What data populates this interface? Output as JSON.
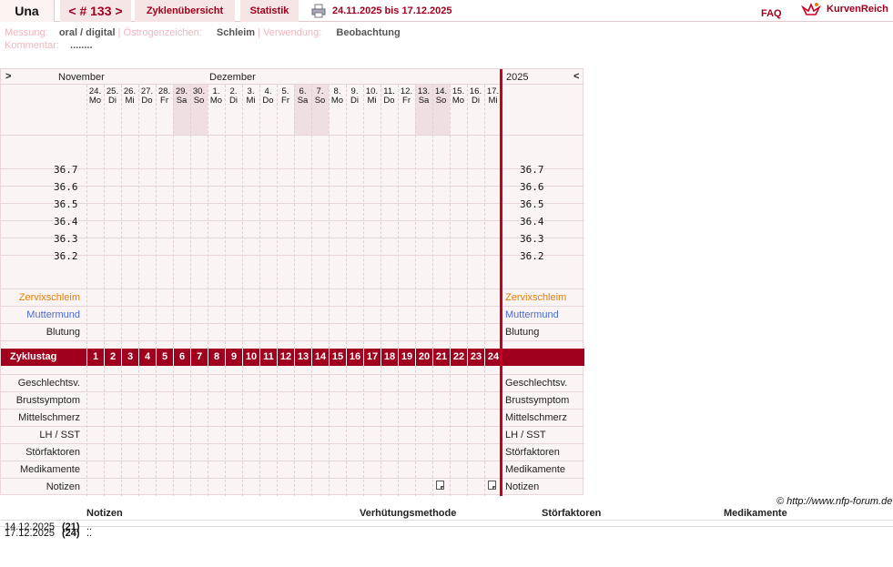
{
  "header": {
    "user": "Una",
    "cycle": "< # 133 >",
    "overview": "Zyklenübersicht",
    "stats": "Statistik",
    "range": "24.11.2025 bis 17.12.2025",
    "faq": "FAQ",
    "logo": "KurvenReich"
  },
  "meta": {
    "messung_label": "Messung:",
    "messung": "oral / digital",
    "oestrogen_label": "Östrogenzeichen:",
    "oestrogen": "Schleim",
    "verwendung_label": "Verwendung:",
    "verwendung": "Beobachtung",
    "kommentar_label": "Kommentar:",
    "kommentar": "........"
  },
  "chart": {
    "nav_prev": ">",
    "nav_next": "<",
    "month1": "November",
    "month2": "Dezember",
    "year": "2025",
    "days": [
      {
        "d": "24.",
        "w": "Mo"
      },
      {
        "d": "25.",
        "w": "Di"
      },
      {
        "d": "26.",
        "w": "Mi"
      },
      {
        "d": "27.",
        "w": "Do"
      },
      {
        "d": "28.",
        "w": "Fr"
      },
      {
        "d": "29.",
        "w": "Sa"
      },
      {
        "d": "30.",
        "w": "So"
      },
      {
        "d": "1.",
        "w": "Mo"
      },
      {
        "d": "2.",
        "w": "Di"
      },
      {
        "d": "3.",
        "w": "Mi"
      },
      {
        "d": "4.",
        "w": "Do"
      },
      {
        "d": "5.",
        "w": "Fr"
      },
      {
        "d": "6.",
        "w": "Sa"
      },
      {
        "d": "7.",
        "w": "So"
      },
      {
        "d": "8.",
        "w": "Mo"
      },
      {
        "d": "9.",
        "w": "Di"
      },
      {
        "d": "10.",
        "w": "Mi"
      },
      {
        "d": "11.",
        "w": "Do"
      },
      {
        "d": "12.",
        "w": "Fr"
      },
      {
        "d": "13.",
        "w": "Sa"
      },
      {
        "d": "14.",
        "w": "So"
      },
      {
        "d": "15.",
        "w": "Mo"
      },
      {
        "d": "16.",
        "w": "Di"
      },
      {
        "d": "17.",
        "w": "Mi"
      }
    ],
    "temps": [
      "36.7",
      "36.6",
      "36.5",
      "36.4",
      "36.3",
      "36.2"
    ],
    "zervix": "Zervixschleim",
    "muttermund": "Muttermund",
    "blutung": "Blutung",
    "zyklustag": "Zyklustag",
    "days_num": [
      "1",
      "2",
      "3",
      "4",
      "5",
      "6",
      "7",
      "8",
      "9",
      "10",
      "11",
      "12",
      "13",
      "14",
      "15",
      "16",
      "17",
      "18",
      "19",
      "20",
      "21",
      "22",
      "23",
      "24"
    ],
    "rows2": [
      "Geschlechtsv.",
      "Brustsymptom",
      "Mittelschmerz",
      "LH / SST",
      "Störfaktoren",
      "Medikamente",
      "Notizen"
    ],
    "colors": {
      "zervix": "#e87d00",
      "muttermund": "#4a6ad0",
      "accent": "#a0001e"
    }
  },
  "footer": {
    "copyright": "© http://www.nfp-forum.de",
    "cols": [
      "Notizen",
      "Verhütungsmethode",
      "Störfaktoren",
      "Medikamente"
    ],
    "entries": [
      {
        "date": "14.12.2025",
        "day": "(21)",
        "text": ".."
      },
      {
        "date": "17.12.2025",
        "day": "(24)",
        "text": ".."
      }
    ]
  }
}
